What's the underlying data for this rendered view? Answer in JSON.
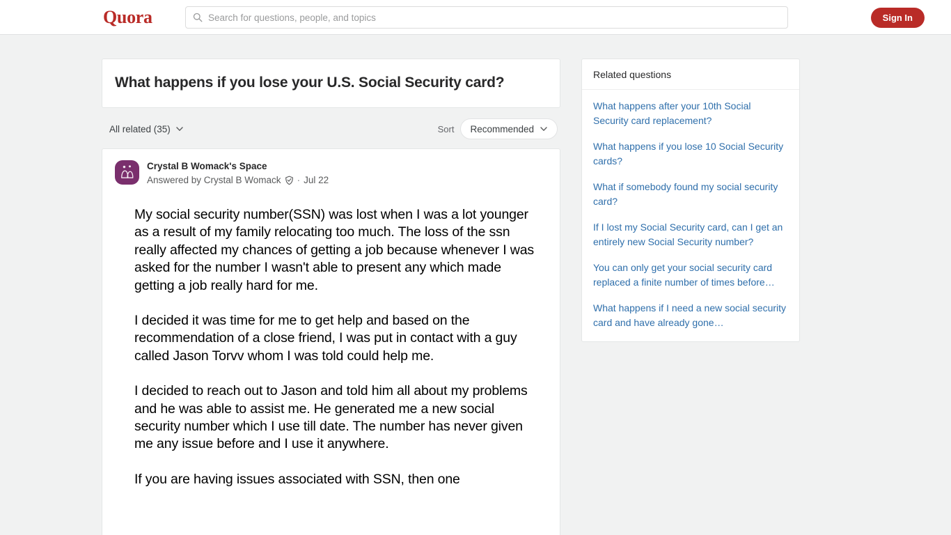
{
  "header": {
    "logo_text": "Quora",
    "search": {
      "placeholder": "Search for questions, people, and topics",
      "value": "",
      "icon": "search-icon"
    },
    "signin_label": "Sign In",
    "accent_color": "#b92b27"
  },
  "question": {
    "title": "What happens if you lose your U.S. Social Security card?"
  },
  "filters": {
    "all_related_label": "All related (35)",
    "sort_label": "Sort",
    "sort_value": "Recommended",
    "chevron_icon": "chevron-down-icon"
  },
  "answer": {
    "space_name": "Crystal B Womack's Space",
    "answered_by": "Answered by Crystal B Womack",
    "verified_icon": "shield-badge-icon",
    "separator": "·",
    "date": "Jul 22",
    "avatar_icon": "space-people-icon",
    "avatar_color": "#7a2f6d",
    "paragraphs": [
      "My social security number(SSN) was lost when I was a lot younger as a result of my family relocating too much. The loss of the ssn really affected my chances of getting a job because whenever I was asked for the number I wasn't able to present any which made getting a job really hard for me.",
      "I decided it was time for me to get help and based on the recommendation of a close friend, I was put in contact with a guy called Jason Torvv whom I was told could help me.",
      "I decided to reach out to Jason and told him all about my problems and he was able to assist me. He generated me a new social security number which I use till date. The number has never given me any issue before and I use it anywhere.",
      "If you are having issues associated with SSN, then one"
    ]
  },
  "related": {
    "heading": "Related questions",
    "items": [
      {
        "text": "What happens after your 10th Social Security card replacement?"
      },
      {
        "text": "What happens if you lose 10 Social Security cards?"
      },
      {
        "text": "What if somebody found my social security card?"
      },
      {
        "text": "If I lost my Social Security card, can I get an entirely new Social Security number?"
      },
      {
        "text": "You can only get your social security card replaced a finite number of times before…"
      },
      {
        "text": "What happens if I need a new social security card and have already gone…"
      }
    ],
    "link_color": "#2f6fab"
  }
}
